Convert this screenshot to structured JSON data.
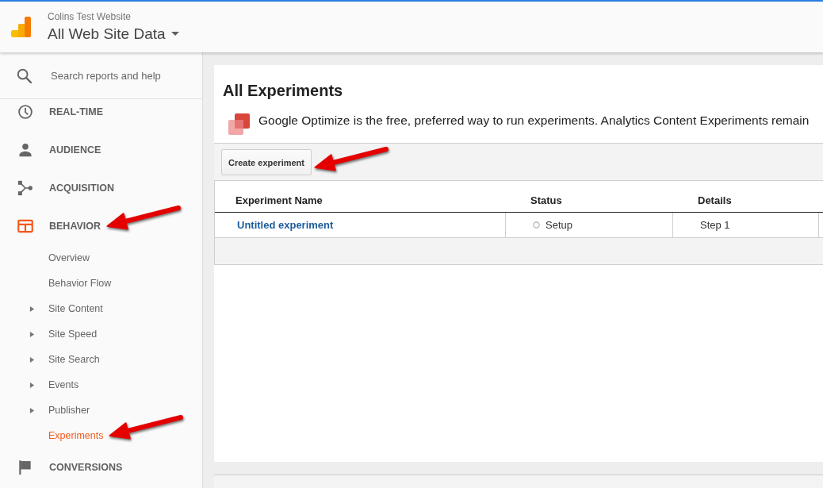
{
  "header": {
    "account": "Colins Test Website",
    "view": "All Web Site Data"
  },
  "sidebar": {
    "search": {
      "placeholder": "Search reports and help"
    },
    "nav_items": [
      {
        "label": "REAL-TIME",
        "selected": false,
        "arrow_annotation": false
      },
      {
        "label": "AUDIENCE",
        "selected": false,
        "arrow_annotation": false
      },
      {
        "label": "ACQUISITION",
        "selected": false,
        "arrow_annotation": false
      },
      {
        "label": "BEHAVIOR",
        "selected": true,
        "arrow_annotation": true,
        "children": [
          {
            "label": "Overview",
            "kind": "page",
            "selected": false,
            "arrow_annotation": false
          },
          {
            "label": "Behavior Flow",
            "kind": "page",
            "selected": false,
            "arrow_annotation": false
          },
          {
            "label": "Site Content",
            "kind": "group",
            "expanded": false,
            "selected": false,
            "arrow_annotation": false
          },
          {
            "label": "Site Speed",
            "kind": "group",
            "expanded": false,
            "selected": false,
            "arrow_annotation": false
          },
          {
            "label": "Site Search",
            "kind": "group",
            "expanded": false,
            "selected": false,
            "arrow_annotation": false
          },
          {
            "label": "Events",
            "kind": "group",
            "expanded": false,
            "selected": false,
            "arrow_annotation": false
          },
          {
            "label": "Publisher",
            "kind": "group",
            "expanded": false,
            "selected": false,
            "arrow_annotation": false
          },
          {
            "label": "Experiments",
            "kind": "page",
            "selected": true,
            "arrow_annotation": true
          }
        ]
      },
      {
        "label": "CONVERSIONS",
        "selected": false,
        "arrow_annotation": false
      }
    ]
  },
  "content": {
    "title": "All Experiments",
    "notice": "Google Optimize is the free, preferred way to run experiments. Analytics Content Experiments remain",
    "toolbar": {
      "create_button": {
        "label": "Create experiment",
        "arrow_annotation": true
      }
    },
    "table": {
      "columns": [
        "Experiment Name",
        "Status",
        "Details"
      ],
      "rows": [
        {
          "name": "Untitled experiment",
          "status": "Setup",
          "details": "Step 1"
        }
      ]
    }
  }
}
